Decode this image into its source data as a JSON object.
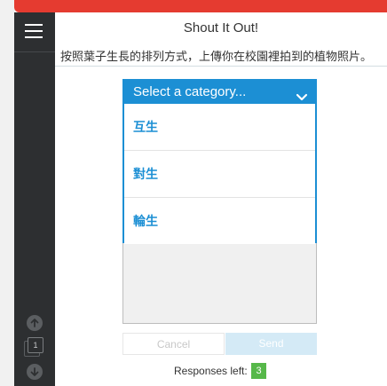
{
  "app": {
    "title": "Shout It Out!",
    "prompt": "按照葉子生長的排列方式，上傳你在校園裡拍到的植物照片。",
    "accent_color": "#1c8fd4",
    "top_bar_color": "#e53b30"
  },
  "rail": {
    "menu_icon": "hamburger-menu-icon",
    "up_icon": "arrow-up-icon",
    "down_icon": "arrow-down-icon",
    "page_number": "1"
  },
  "category_select": {
    "placeholder": "Select a category...",
    "expanded": true,
    "options": [
      "互生",
      "對生",
      "輪生"
    ]
  },
  "buttons": {
    "cancel": "Cancel",
    "send": "Send"
  },
  "footer": {
    "responses_label": "Responses left:",
    "responses_count": "3"
  }
}
